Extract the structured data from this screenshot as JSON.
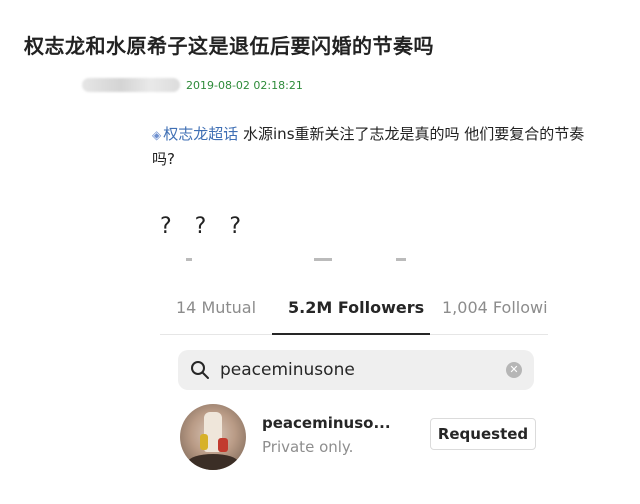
{
  "post": {
    "title": "权志龙和水原希子这是退伍后要闪婚的节奏吗",
    "timestamp": "2019-08-02 02:18:21",
    "topic_tag": "权志龙超话",
    "body_text": " 水源ins重新关注了志龙是真的吗 他们要复合的节奏吗?",
    "question_marks": "? ? ?"
  },
  "instagram": {
    "tabs": [
      {
        "label": "14 Mutual",
        "active": false
      },
      {
        "label": "5.2M Followers",
        "active": true
      },
      {
        "label": "1,004 Followi",
        "active": false
      }
    ],
    "search": {
      "value": "peaceminusone"
    },
    "result": {
      "username": "peaceminuso...",
      "subtitle": "Private only.",
      "button_label": "Requested"
    }
  },
  "colors": {
    "timestamp": "#2e8b3a",
    "topic_link": "#3f6fb4",
    "active_tab": "#262626",
    "inactive_tab": "#8c8c8c"
  }
}
